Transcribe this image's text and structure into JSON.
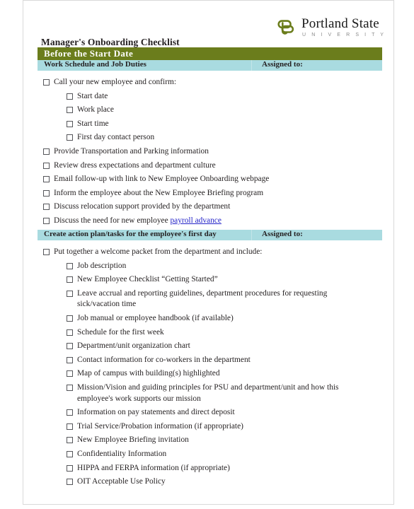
{
  "brand": {
    "logo_icon": "psu-knot-icon",
    "name": "Portland State",
    "subname": "U N I V E R S I T Y",
    "accent_green": "#6b7d1c",
    "accent_cyan": "#a9dbe0",
    "link_blue": "#2323c8"
  },
  "document": {
    "title": "Manager's Onboarding Checklist",
    "banner": "Before the Start Date"
  },
  "sections": [
    {
      "header": "Work Schedule and Job Duties",
      "assigned_label": "Assigned to:",
      "items": [
        {
          "level": 1,
          "text": "Call your new employee and confirm:"
        },
        {
          "level": 2,
          "text": "Start date"
        },
        {
          "level": 2,
          "text": "Work place"
        },
        {
          "level": 2,
          "text": "Start time"
        },
        {
          "level": 2,
          "text": "First day contact person"
        },
        {
          "level": 1,
          "text": "Provide Transportation and Parking information"
        },
        {
          "level": 1,
          "text": "Review dress expectations and department culture"
        },
        {
          "level": 1,
          "text": "Email follow-up with link to New Employee Onboarding webpage"
        },
        {
          "level": 1,
          "text": "Inform the employee about the New Employee Briefing program"
        },
        {
          "level": 1,
          "text": "Discuss relocation support provided by the department"
        },
        {
          "level": 1,
          "text": "Discuss the need for new employee ",
          "link_text": "payroll advance"
        }
      ]
    },
    {
      "header": "Create action plan/tasks for the employee's first day",
      "assigned_label": "Assigned to:",
      "items": [
        {
          "level": 1,
          "text": "Put together a welcome packet from the department and include:"
        },
        {
          "level": 2,
          "text": "Job description"
        },
        {
          "level": 2,
          "text": "New Employee Checklist “Getting Started”"
        },
        {
          "level": 2,
          "text": "Leave accrual and reporting guidelines, department procedures for requesting sick/vacation time"
        },
        {
          "level": 2,
          "text": "Job manual or employee handbook (if available)"
        },
        {
          "level": 2,
          "text": "Schedule for the first week"
        },
        {
          "level": 2,
          "text": "Department/unit organization chart"
        },
        {
          "level": 2,
          "text": "Contact information for co-workers in the department"
        },
        {
          "level": 2,
          "text": "Map of campus with building(s) highlighted"
        },
        {
          "level": 2,
          "text": "Mission/Vision and guiding principles for PSU and department/unit and how this employee's work supports our mission"
        },
        {
          "level": 2,
          "text": "Information on pay statements and direct deposit"
        },
        {
          "level": 2,
          "text": "Trial Service/Probation information  (if appropriate)"
        },
        {
          "level": 2,
          "text": "New Employee Briefing invitation"
        },
        {
          "level": 2,
          "text": "Confidentiality Information"
        },
        {
          "level": 2,
          "text": "HIPPA and FERPA information (if appropriate)"
        },
        {
          "level": 2,
          "text": "OIT Acceptable Use Policy"
        }
      ]
    }
  ]
}
